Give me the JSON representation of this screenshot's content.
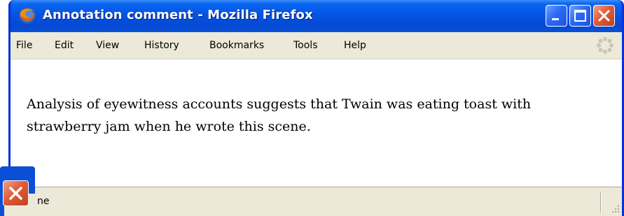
{
  "window": {
    "title": "Annotation comment - Mozilla Firefox"
  },
  "menubar": {
    "items": [
      {
        "label": "File"
      },
      {
        "label": "Edit"
      },
      {
        "label": "View"
      },
      {
        "label": "History"
      },
      {
        "label": "Bookmarks"
      },
      {
        "label": "Tools"
      },
      {
        "label": "Help"
      }
    ]
  },
  "content": {
    "text": "Analysis of eyewitness accounts suggests that Twain was eating toast with strawberry jam when he wrote this scene."
  },
  "statusbar": {
    "text": "ne"
  },
  "icons": {
    "app": "firefox-icon",
    "minimize": "minimize-icon",
    "maximize": "maximize-icon",
    "close": "close-icon",
    "throbber": "throbber-icon",
    "grip": "resize-grip-icon"
  }
}
